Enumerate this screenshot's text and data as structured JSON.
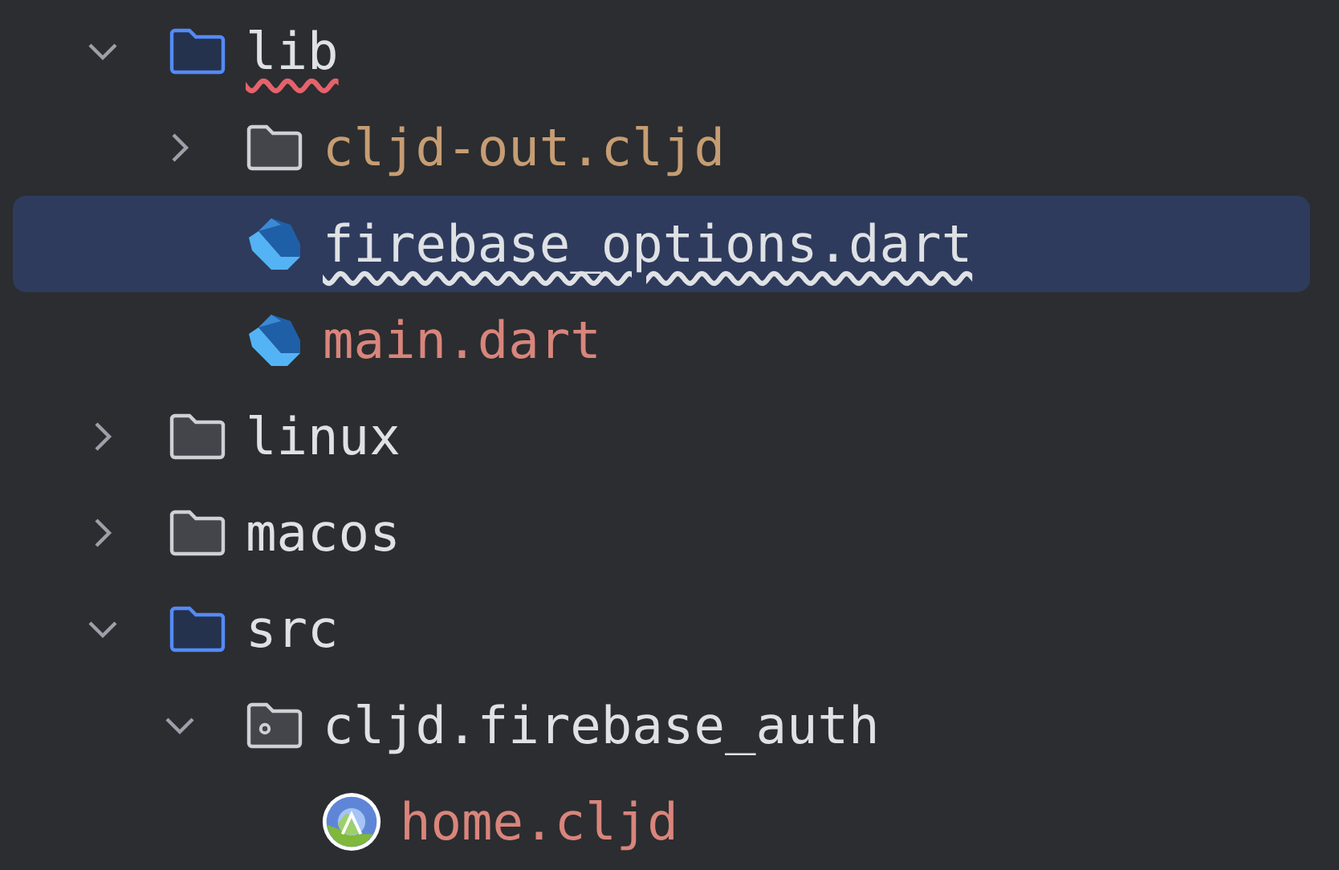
{
  "tree": {
    "items": [
      {
        "kind": "source-folder",
        "label": "lib",
        "expanded": true,
        "selected": false,
        "color": "#dfe1e5",
        "error": true,
        "warning": false,
        "children": [
          {
            "kind": "folder",
            "label": "cljd-out.cljd",
            "expanded": false,
            "selected": false,
            "color": "#c69d73",
            "error": false,
            "warning": false
          },
          {
            "kind": "dart",
            "label": "firebase_options.dart",
            "selected": true,
            "color": "#dfe1e5",
            "error": false,
            "warning": true
          },
          {
            "kind": "dart",
            "label": "main.dart",
            "selected": false,
            "color": "#d9857c",
            "error": false,
            "warning": false
          }
        ]
      },
      {
        "kind": "folder",
        "label": "linux",
        "expanded": false,
        "selected": false,
        "color": "#dfe1e5",
        "error": false,
        "warning": false
      },
      {
        "kind": "folder",
        "label": "macos",
        "expanded": false,
        "selected": false,
        "color": "#dfe1e5",
        "error": false,
        "warning": false
      },
      {
        "kind": "source-folder",
        "label": "src",
        "expanded": true,
        "selected": false,
        "color": "#dfe1e5",
        "error": false,
        "warning": false,
        "children": [
          {
            "kind": "package",
            "label": "cljd.firebase_auth",
            "expanded": true,
            "selected": false,
            "color": "#dfe1e5",
            "error": false,
            "warning": false,
            "children": [
              {
                "kind": "clojure",
                "label": "home.cljd",
                "selected": false,
                "color": "#d9857c",
                "error": false,
                "warning": false
              }
            ]
          }
        ]
      }
    ]
  }
}
